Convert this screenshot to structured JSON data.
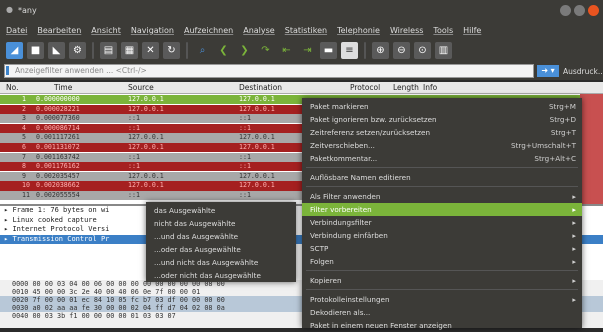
{
  "window": {
    "title": "*any"
  },
  "menu": [
    "Datei",
    "Bearbeiten",
    "Ansicht",
    "Navigation",
    "Aufzeichnen",
    "Analyse",
    "Statistiken",
    "Telephonie",
    "Wireless",
    "Tools",
    "Hilfe"
  ],
  "toolbar": {
    "icons": [
      "shark-start-icon",
      "stop-icon",
      "restart-icon",
      "options-icon",
      "open-file-icon",
      "save-icon",
      "close-file-icon",
      "reload-icon",
      "find-icon",
      "back-icon",
      "forward-icon",
      "goto-icon",
      "first-icon",
      "last-icon",
      "autoscroll-icon",
      "colorize-icon",
      "zoom-in-icon",
      "zoom-out-icon",
      "zoom-normal-icon",
      "resize-columns-icon"
    ]
  },
  "filter": {
    "placeholder": "Anzeigefilter anwenden ... <Ctrl-/>",
    "expression_label": "Ausdruck..."
  },
  "columns": {
    "no": "No.",
    "time": "Time",
    "source": "Source",
    "destination": "Destination",
    "protocol": "Protocol",
    "length": "Length",
    "info": "Info"
  },
  "packets": [
    {
      "no": "1",
      "time": "0.000000000",
      "src": "127.0.0.1",
      "dst": "127.0.0.1",
      "style": "sel"
    },
    {
      "no": "2",
      "time": "0.000028221",
      "src": "127.0.0.1",
      "dst": "127.0.0.1",
      "style": "red"
    },
    {
      "no": "3",
      "time": "0.000077360",
      "src": "::1",
      "dst": "::1",
      "style": "grey"
    },
    {
      "no": "4",
      "time": "0.000086714",
      "src": "::1",
      "dst": "::1",
      "style": "red"
    },
    {
      "no": "5",
      "time": "0.001117261",
      "src": "127.0.0.1",
      "dst": "127.0.0.1",
      "style": "grey"
    },
    {
      "no": "6",
      "time": "0.001131072",
      "src": "127.0.0.1",
      "dst": "127.0.0.1",
      "style": "red"
    },
    {
      "no": "7",
      "time": "0.001163742",
      "src": "::1",
      "dst": "::1",
      "style": "grey"
    },
    {
      "no": "8",
      "time": "0.001176162",
      "src": "::1",
      "dst": "::1",
      "style": "red"
    },
    {
      "no": "9",
      "time": "0.002035457",
      "src": "127.0.0.1",
      "dst": "127.0.0.1",
      "style": "grey"
    },
    {
      "no": "10",
      "time": "0.002038662",
      "src": "127.0.0.1",
      "dst": "127.0.0.1",
      "style": "red"
    },
    {
      "no": "11",
      "time": "0.002055554",
      "src": "::1",
      "dst": "::1",
      "style": "grey"
    }
  ],
  "details": [
    "Frame 1: 76 bytes on wi",
    "Linux cooked capture",
    "Internet Protocol Versi",
    "Transmission Control Pr"
  ],
  "hex": [
    "0000   00 00 03 04 00 06 00 00 00 00 00 00 00 00 08 00",
    "0010   45 00 00 3c 2e 40 00 40 06 0e 7f 00 00 01",
    "0020   7f 00 00 01 ec 84 10 05 fc b7 03 df 00 00 00 00",
    "0030   a0 02 aa aa fe 30 00 00 02 04 ff d7 04 02 08 0a",
    "0040   00 03 3b f1 00 00 00 00 01 03 03 07"
  ],
  "context_menu": {
    "items": [
      {
        "label": "Paket markieren",
        "shortcut": "Strg+M"
      },
      {
        "label": "Paket ignorieren bzw. zurücksetzen",
        "shortcut": "Strg+D"
      },
      {
        "label": "Zeitreferenz setzen/zurücksetzen",
        "shortcut": "Strg+T"
      },
      {
        "label": "Zeitverschieben...",
        "shortcut": "Strg+Umschalt+T"
      },
      {
        "label": "Paketkommentar...",
        "shortcut": "Strg+Alt+C"
      },
      {
        "label": "Auflösbare Namen editieren",
        "shortcut": ""
      },
      {
        "label": "Als Filter anwenden",
        "shortcut": ""
      },
      {
        "label": "Filter vorbereiten",
        "shortcut": ""
      },
      {
        "label": "Verbindungsfilter",
        "shortcut": ""
      },
      {
        "label": "Verbindung einfärben",
        "shortcut": ""
      },
      {
        "label": "SCTP",
        "shortcut": ""
      },
      {
        "label": "Folgen",
        "shortcut": ""
      },
      {
        "label": "Kopieren",
        "shortcut": ""
      },
      {
        "label": "Protokolleinstellungen",
        "shortcut": ""
      },
      {
        "label": "Dekodieren als...",
        "shortcut": ""
      },
      {
        "label": "Paket in einem neuen Fenster anzeigen",
        "shortcut": ""
      }
    ]
  },
  "submenu": {
    "items": [
      "das Ausgewählte",
      "nicht das Ausgewählte",
      "...und das Ausgewählte",
      "...oder das Ausgewählte",
      "...und nicht das Ausgewählte",
      "...oder nicht das Ausgewählte"
    ]
  },
  "colors": {
    "chrome": "#3c3b37",
    "selected": "#7bb43a",
    "red_row": "#a52020",
    "grey_row": "#a8a8a8",
    "accent": "#4a90d9",
    "close_button": "#e95420"
  }
}
